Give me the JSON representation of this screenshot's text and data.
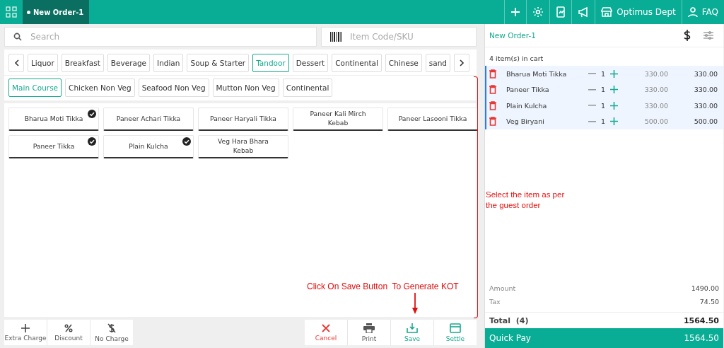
{
  "topbar": {
    "tab": {
      "label": "New Order-1",
      "selected": true
    },
    "department": "Optimus Dept",
    "help": "FAQ"
  },
  "search": {
    "placeholder": "Search"
  },
  "sku": {
    "placeholder": "Item Code/SKU"
  },
  "categories": [
    {
      "label": "Liquor",
      "selected": false
    },
    {
      "label": "Breakfast",
      "selected": false
    },
    {
      "label": "Beverage",
      "selected": false
    },
    {
      "label": "Indian",
      "selected": false
    },
    {
      "label": "Soup & Starter",
      "selected": false
    },
    {
      "label": "Tandoor",
      "selected": true
    },
    {
      "label": "Dessert",
      "selected": false
    },
    {
      "label": "Continental",
      "selected": false
    },
    {
      "label": "Chinese",
      "selected": false
    },
    {
      "label": "sand",
      "selected": false
    }
  ],
  "subcategories": [
    {
      "label": "Main Course",
      "selected": true
    },
    {
      "label": "Chicken Non Veg",
      "selected": false
    },
    {
      "label": "Seafood Non Veg",
      "selected": false
    },
    {
      "label": "Mutton Non Veg",
      "selected": false
    },
    {
      "label": "Continental",
      "selected": false
    }
  ],
  "menu_items": [
    {
      "name": "Bharua Moti Tikka",
      "checked": true
    },
    {
      "name": "Paneer Achari Tikka",
      "checked": false
    },
    {
      "name": "Paneer Haryali Tikka",
      "checked": false
    },
    {
      "name": "Paneer Kali Mirch Kebab",
      "checked": false
    },
    {
      "name": "Paneer Lasooni Tikka",
      "checked": false
    },
    {
      "name": "Paneer Tikka",
      "checked": true
    },
    {
      "name": "Plain Kulcha",
      "checked": true
    },
    {
      "name": "Veg Hara Bhara Kebab",
      "checked": false
    }
  ],
  "bottom_left": [
    {
      "kind": "extra",
      "label": "Extra Charge"
    },
    {
      "kind": "discount",
      "label": "Discount"
    },
    {
      "kind": "nocharge",
      "label": "No Charge"
    }
  ],
  "bottom_right": [
    {
      "kind": "cancel",
      "label": "Cancel"
    },
    {
      "kind": "print",
      "label": "Print"
    },
    {
      "kind": "save",
      "label": "Save"
    },
    {
      "kind": "settle",
      "label": "Settle"
    }
  ],
  "order": {
    "title": "New Order-1",
    "cart_count": "4 item(s) in cart",
    "items": [
      {
        "name": "Bharua Moti Tikka",
        "qty": "1",
        "price": "330.00",
        "total": "330.00"
      },
      {
        "name": "Paneer Tikka",
        "qty": "1",
        "price": "330.00",
        "total": "330.00"
      },
      {
        "name": "Plain Kulcha",
        "qty": "1",
        "price": "330.00",
        "total": "330.00"
      },
      {
        "name": "Veg Biryani",
        "qty": "1",
        "price": "500.00",
        "total": "500.00"
      }
    ],
    "amount_label": "Amount",
    "amount": "1490.00",
    "tax_label": "Tax",
    "tax": "74.50",
    "total_label": "Total  (4)",
    "total": "1564.50",
    "quick_pay_label": "Quick Pay",
    "quick_pay": "1564.50"
  },
  "annotations": {
    "select_hint": "Select the item as per the guest order",
    "save_hint": "Click On Save Button  To Generate KOT"
  }
}
